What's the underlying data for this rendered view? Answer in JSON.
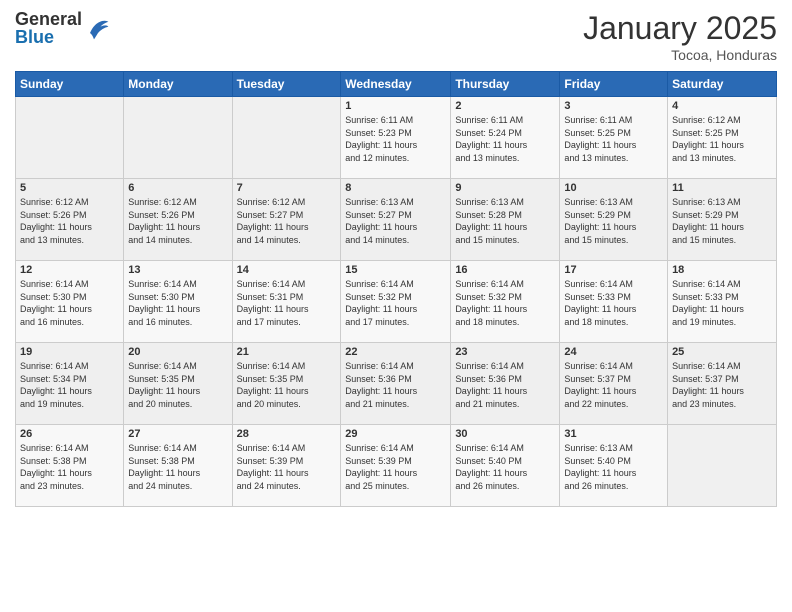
{
  "header": {
    "logo_general": "General",
    "logo_blue": "Blue",
    "month_title": "January 2025",
    "location": "Tocoa, Honduras"
  },
  "days_of_week": [
    "Sunday",
    "Monday",
    "Tuesday",
    "Wednesday",
    "Thursday",
    "Friday",
    "Saturday"
  ],
  "weeks": [
    [
      {
        "day": "",
        "info": ""
      },
      {
        "day": "",
        "info": ""
      },
      {
        "day": "",
        "info": ""
      },
      {
        "day": "1",
        "info": "Sunrise: 6:11 AM\nSunset: 5:23 PM\nDaylight: 11 hours\nand 12 minutes."
      },
      {
        "day": "2",
        "info": "Sunrise: 6:11 AM\nSunset: 5:24 PM\nDaylight: 11 hours\nand 13 minutes."
      },
      {
        "day": "3",
        "info": "Sunrise: 6:11 AM\nSunset: 5:25 PM\nDaylight: 11 hours\nand 13 minutes."
      },
      {
        "day": "4",
        "info": "Sunrise: 6:12 AM\nSunset: 5:25 PM\nDaylight: 11 hours\nand 13 minutes."
      }
    ],
    [
      {
        "day": "5",
        "info": "Sunrise: 6:12 AM\nSunset: 5:26 PM\nDaylight: 11 hours\nand 13 minutes."
      },
      {
        "day": "6",
        "info": "Sunrise: 6:12 AM\nSunset: 5:26 PM\nDaylight: 11 hours\nand 14 minutes."
      },
      {
        "day": "7",
        "info": "Sunrise: 6:12 AM\nSunset: 5:27 PM\nDaylight: 11 hours\nand 14 minutes."
      },
      {
        "day": "8",
        "info": "Sunrise: 6:13 AM\nSunset: 5:27 PM\nDaylight: 11 hours\nand 14 minutes."
      },
      {
        "day": "9",
        "info": "Sunrise: 6:13 AM\nSunset: 5:28 PM\nDaylight: 11 hours\nand 15 minutes."
      },
      {
        "day": "10",
        "info": "Sunrise: 6:13 AM\nSunset: 5:29 PM\nDaylight: 11 hours\nand 15 minutes."
      },
      {
        "day": "11",
        "info": "Sunrise: 6:13 AM\nSunset: 5:29 PM\nDaylight: 11 hours\nand 15 minutes."
      }
    ],
    [
      {
        "day": "12",
        "info": "Sunrise: 6:14 AM\nSunset: 5:30 PM\nDaylight: 11 hours\nand 16 minutes."
      },
      {
        "day": "13",
        "info": "Sunrise: 6:14 AM\nSunset: 5:30 PM\nDaylight: 11 hours\nand 16 minutes."
      },
      {
        "day": "14",
        "info": "Sunrise: 6:14 AM\nSunset: 5:31 PM\nDaylight: 11 hours\nand 17 minutes."
      },
      {
        "day": "15",
        "info": "Sunrise: 6:14 AM\nSunset: 5:32 PM\nDaylight: 11 hours\nand 17 minutes."
      },
      {
        "day": "16",
        "info": "Sunrise: 6:14 AM\nSunset: 5:32 PM\nDaylight: 11 hours\nand 18 minutes."
      },
      {
        "day": "17",
        "info": "Sunrise: 6:14 AM\nSunset: 5:33 PM\nDaylight: 11 hours\nand 18 minutes."
      },
      {
        "day": "18",
        "info": "Sunrise: 6:14 AM\nSunset: 5:33 PM\nDaylight: 11 hours\nand 19 minutes."
      }
    ],
    [
      {
        "day": "19",
        "info": "Sunrise: 6:14 AM\nSunset: 5:34 PM\nDaylight: 11 hours\nand 19 minutes."
      },
      {
        "day": "20",
        "info": "Sunrise: 6:14 AM\nSunset: 5:35 PM\nDaylight: 11 hours\nand 20 minutes."
      },
      {
        "day": "21",
        "info": "Sunrise: 6:14 AM\nSunset: 5:35 PM\nDaylight: 11 hours\nand 20 minutes."
      },
      {
        "day": "22",
        "info": "Sunrise: 6:14 AM\nSunset: 5:36 PM\nDaylight: 11 hours\nand 21 minutes."
      },
      {
        "day": "23",
        "info": "Sunrise: 6:14 AM\nSunset: 5:36 PM\nDaylight: 11 hours\nand 21 minutes."
      },
      {
        "day": "24",
        "info": "Sunrise: 6:14 AM\nSunset: 5:37 PM\nDaylight: 11 hours\nand 22 minutes."
      },
      {
        "day": "25",
        "info": "Sunrise: 6:14 AM\nSunset: 5:37 PM\nDaylight: 11 hours\nand 23 minutes."
      }
    ],
    [
      {
        "day": "26",
        "info": "Sunrise: 6:14 AM\nSunset: 5:38 PM\nDaylight: 11 hours\nand 23 minutes."
      },
      {
        "day": "27",
        "info": "Sunrise: 6:14 AM\nSunset: 5:38 PM\nDaylight: 11 hours\nand 24 minutes."
      },
      {
        "day": "28",
        "info": "Sunrise: 6:14 AM\nSunset: 5:39 PM\nDaylight: 11 hours\nand 24 minutes."
      },
      {
        "day": "29",
        "info": "Sunrise: 6:14 AM\nSunset: 5:39 PM\nDaylight: 11 hours\nand 25 minutes."
      },
      {
        "day": "30",
        "info": "Sunrise: 6:14 AM\nSunset: 5:40 PM\nDaylight: 11 hours\nand 26 minutes."
      },
      {
        "day": "31",
        "info": "Sunrise: 6:13 AM\nSunset: 5:40 PM\nDaylight: 11 hours\nand 26 minutes."
      },
      {
        "day": "",
        "info": ""
      }
    ]
  ]
}
